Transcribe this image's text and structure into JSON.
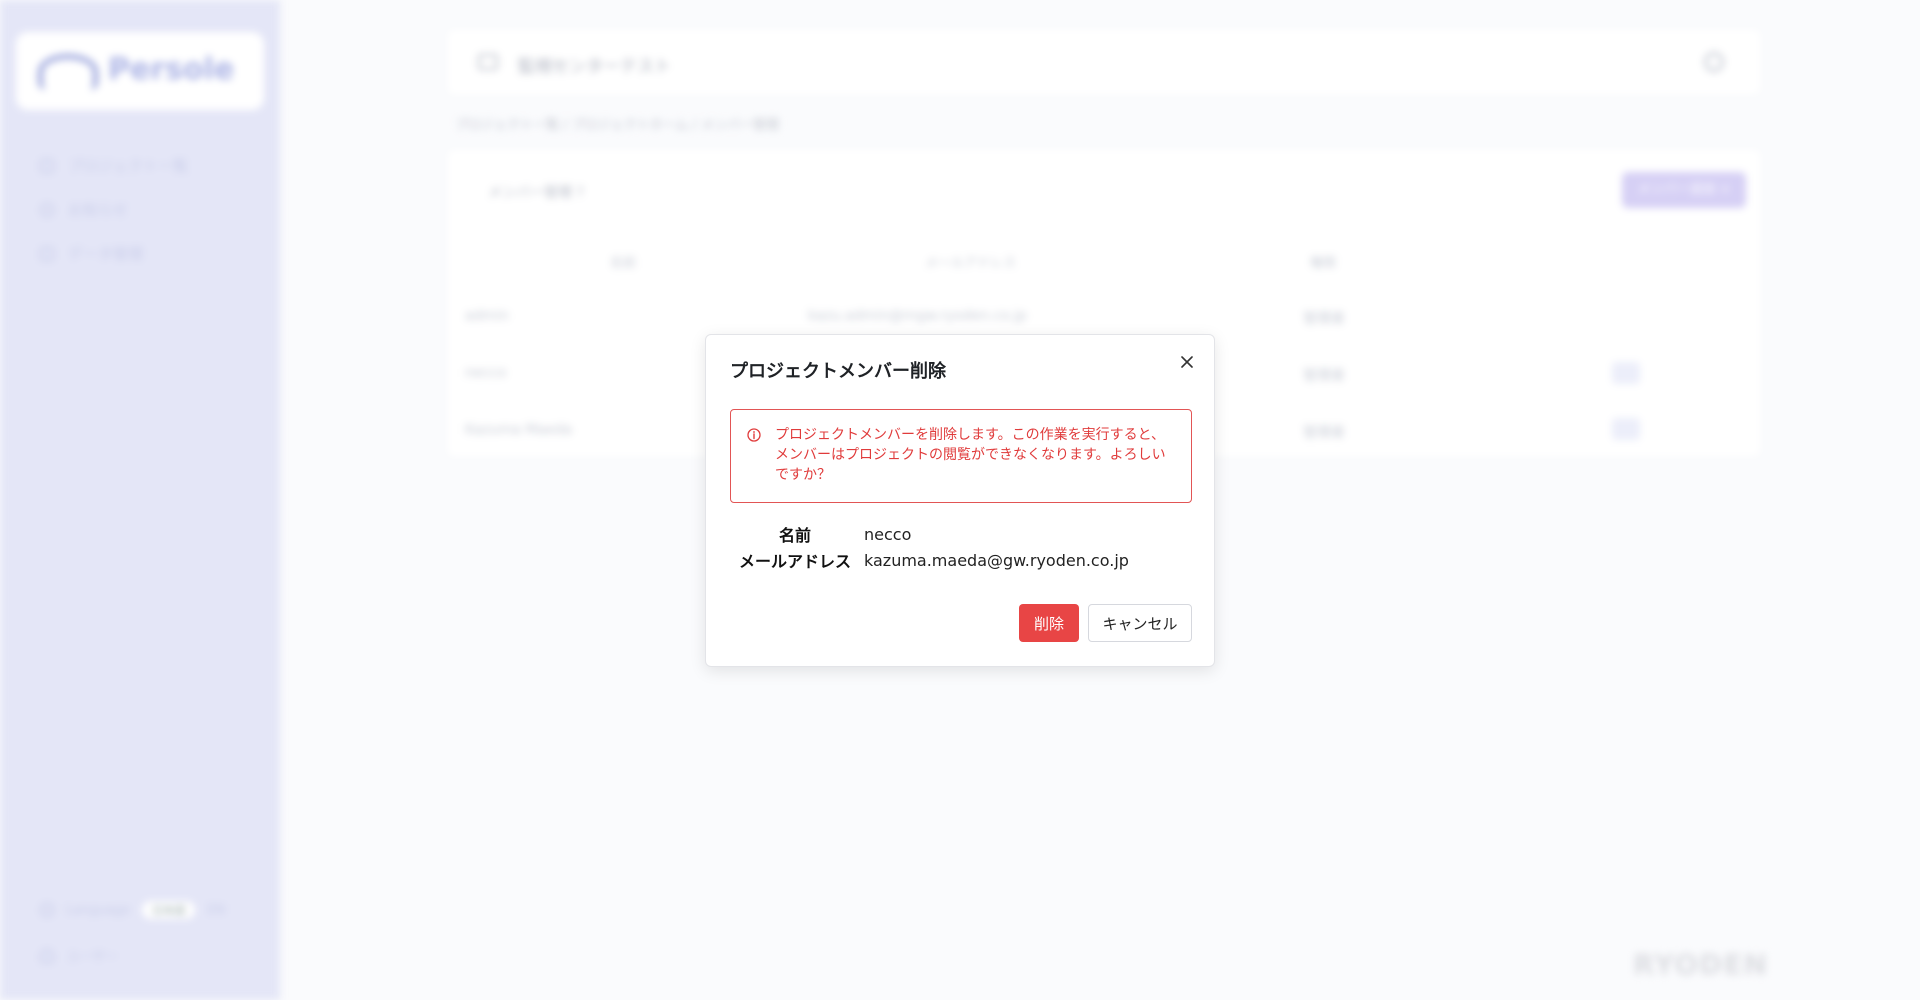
{
  "sidebar": {
    "brand": "Persole",
    "items": [
      {
        "label": "プロジェクト一覧"
      },
      {
        "label": "お知らせ"
      },
      {
        "label": "データ管理"
      }
    ],
    "language_label": "Language",
    "language_value": "日本語",
    "language_alt": "EN",
    "user_label": "ユーザー"
  },
  "header": {
    "title": "監視センターテスト"
  },
  "breadcrumb": "プロジェクト一覧 / プロジェクトホーム / メンバー管理",
  "section": {
    "title": "メンバー管理 ?",
    "add_button": "メンバー追加 +",
    "columns": [
      "名前",
      "メールアドレス",
      "権限"
    ],
    "rows": [
      {
        "name": "admin",
        "email": "kazu.admin@mgw.ryoden.co.jp",
        "role": "管理者"
      },
      {
        "name": "necco",
        "email": "",
        "role": "管理者"
      },
      {
        "name": "Kazuma Maeda",
        "email": "",
        "role": "管理者"
      }
    ]
  },
  "footer_brand": "RYODEN",
  "dialog": {
    "title": "プロジェクトメンバー削除",
    "close_icon": "close-icon",
    "alert_icon": "info-circle-icon",
    "alert_color": "#e03b3b",
    "alert_text": "プロジェクトメンバーを削除します。この作業を実行すると、メンバーはプロジェクトの閲覧ができなくなります。よろしいですか？",
    "name_label": "名前",
    "name_value": "necco",
    "email_label": "メールアドレス",
    "email_value": "kazuma.maeda@gw.ryoden.co.jp",
    "delete_label": "削除",
    "delete_color": "#e84545",
    "cancel_label": "キャンセル"
  }
}
